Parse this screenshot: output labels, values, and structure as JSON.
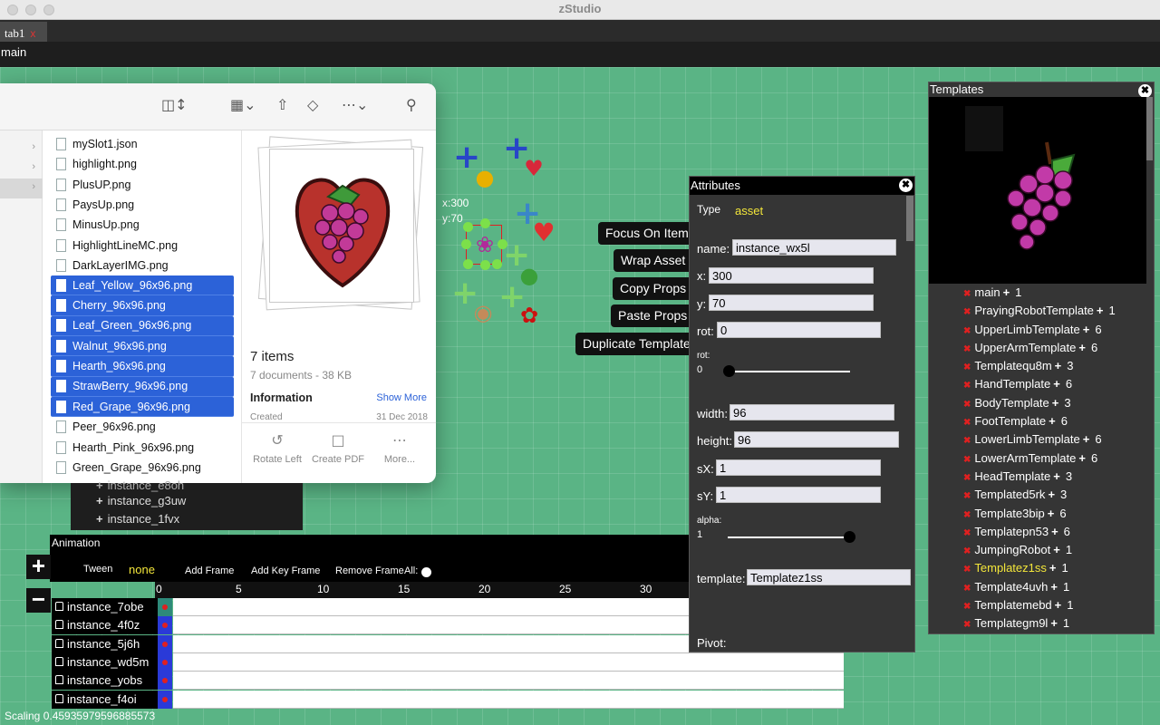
{
  "app_title": "zStudio",
  "tab": {
    "label": "tab1",
    "close": "x"
  },
  "scene_label": "main",
  "canvas": {
    "coord_x": "x:300",
    "coord_y": "y:70",
    "context_buttons": [
      "Focus On Item",
      "Wrap Asset",
      "Copy Props",
      "Paste Props",
      "Duplicate Template"
    ]
  },
  "finder": {
    "files": [
      {
        "name": "mySlot1.json",
        "selected": false
      },
      {
        "name": "highlight.png",
        "selected": false
      },
      {
        "name": "PlusUP.png",
        "selected": false
      },
      {
        "name": "PaysUp.png",
        "selected": false
      },
      {
        "name": "MinusUp.png",
        "selected": false
      },
      {
        "name": "HighlightLineMC.png",
        "selected": false
      },
      {
        "name": "DarkLayerIMG.png",
        "selected": false
      },
      {
        "name": "Leaf_Yellow_96x96.png",
        "selected": true
      },
      {
        "name": "Cherry_96x96.png",
        "selected": true
      },
      {
        "name": "Leaf_Green_96x96.png",
        "selected": true
      },
      {
        "name": "Walnut_96x96.png",
        "selected": true
      },
      {
        "name": "Hearth_96x96.png",
        "selected": true
      },
      {
        "name": "StrawBerry_96x96.png",
        "selected": true
      },
      {
        "name": "Red_Grape_96x96.png",
        "selected": true
      },
      {
        "name": "Peer_96x96.png",
        "selected": false
      },
      {
        "name": "Hearth_Pink_96x96.png",
        "selected": false
      },
      {
        "name": "Green_Grape_96x96.png",
        "selected": false
      }
    ],
    "preview": {
      "title": "7 items",
      "subtitle": "7 documents - 38 KB",
      "info_label": "Information",
      "show_more": "Show More",
      "created_label": "Created",
      "created_date": "31 Dec 2018",
      "actions": [
        "Rotate Left",
        "Create PDF",
        "More..."
      ]
    }
  },
  "hierarchy": {
    "items": [
      "instance_e8oh",
      "instance_g3uw",
      "instance_1fvx"
    ]
  },
  "animation": {
    "title": "Animation",
    "tween_label": "Tween",
    "tween_value": "none",
    "add_frame": "Add Frame",
    "add_key_frame": "Add Key Frame",
    "remove_frame": "Remove Frame",
    "all_label": "All:",
    "ruler": [
      "0",
      "5",
      "10",
      "15",
      "20",
      "25",
      "30"
    ],
    "tracks": [
      "instance_7obe",
      "instance_4f0z",
      "instance_5j6h",
      "instance_wd5m",
      "instance_yobs",
      "instance_f4oi"
    ]
  },
  "scaling_text": "Scaling 0.45935979596885573",
  "attributes": {
    "title": "Attributes",
    "type_label": "Type",
    "type_value": "asset",
    "name_label": "name:",
    "name_value": "instance_wx5l",
    "x_label": "x:",
    "x_value": "300",
    "y_label": "y:",
    "y_value": "70",
    "rot_label": "rot:",
    "rot_value": "0",
    "rot_slider_label": "rot:",
    "rot_slider_value": "0",
    "width_label": "width:",
    "width_value": "96",
    "height_label": "height:",
    "height_value": "96",
    "sx_label": "sX:",
    "sx_value": "1",
    "sy_label": "sY:",
    "sy_value": "1",
    "alpha_label": "alpha:",
    "alpha_value": "1",
    "template_label": "template:",
    "template_value": "Templatez1ss",
    "pivot_label": "Pivot:"
  },
  "templates": {
    "title": "Templates",
    "items": [
      {
        "name": "main",
        "count": "1",
        "active": false
      },
      {
        "name": "PrayingRobotTemplate",
        "count": "1",
        "active": false
      },
      {
        "name": "UpperLimbTemplate",
        "count": "6",
        "active": false
      },
      {
        "name": "UpperArmTemplate",
        "count": "6",
        "active": false
      },
      {
        "name": "Templatequ8m",
        "count": "3",
        "active": false
      },
      {
        "name": "HandTemplate",
        "count": "6",
        "active": false
      },
      {
        "name": "BodyTemplate",
        "count": "3",
        "active": false
      },
      {
        "name": "FootTemplate",
        "count": "6",
        "active": false
      },
      {
        "name": "LowerLimbTemplate",
        "count": "6",
        "active": false
      },
      {
        "name": "LowerArmTemplate",
        "count": "6",
        "active": false
      },
      {
        "name": "HeadTemplate",
        "count": "3",
        "active": false
      },
      {
        "name": "Templated5rk",
        "count": "3",
        "active": false
      },
      {
        "name": "Template3bip",
        "count": "6",
        "active": false
      },
      {
        "name": "Templatepn53",
        "count": "6",
        "active": false
      },
      {
        "name": "JumpingRobot",
        "count": "1",
        "active": false
      },
      {
        "name": "Templatez1ss",
        "count": "1",
        "active": true
      },
      {
        "name": "Template4uvh",
        "count": "1",
        "active": false
      },
      {
        "name": "Templatemebd",
        "count": "1",
        "active": false
      },
      {
        "name": "Templategm9l",
        "count": "1",
        "active": false
      }
    ]
  },
  "colors": {
    "canvas": "#5ab485",
    "selection": "#2c62d8",
    "accent_yellow": "#f3e63a",
    "remove_red": "#e02020"
  },
  "icons": [
    "columns-view-icon",
    "grid-view-icon",
    "share-icon",
    "tag-icon",
    "more-icon",
    "search-icon",
    "grape-icon",
    "heart-icon",
    "strawberry-icon",
    "cherry-icon",
    "walnut-icon",
    "leaf-icon"
  ]
}
